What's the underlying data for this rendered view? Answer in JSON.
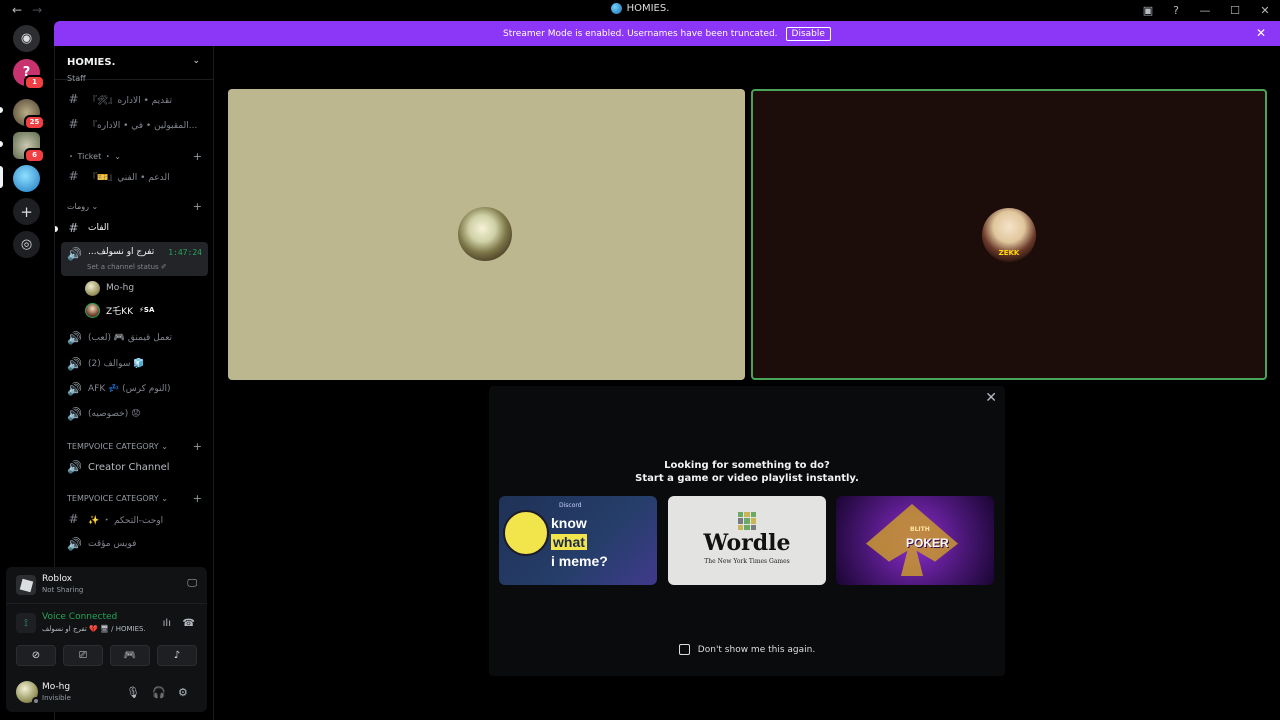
{
  "window": {
    "title": "HOMIES.",
    "back_glyph": "←",
    "forward_glyph": "→",
    "controls": [
      "▣",
      "?",
      "—",
      "☐",
      "✕"
    ]
  },
  "servers": [
    {
      "name": "discord-home",
      "glyph": "◉",
      "color": "#2b2d31",
      "badge": ""
    },
    {
      "name": "server-question",
      "glyph": "?",
      "color": "#c8326e",
      "badge": "1"
    },
    {
      "name": "server-avatar-a",
      "glyph": "",
      "color": "#5a4e3b",
      "badge": "25"
    },
    {
      "name": "server-avatar-b",
      "glyph": "",
      "color": "#7d8a6a",
      "badge": "6"
    },
    {
      "name": "server-avatar-c",
      "glyph": "",
      "color": "#2a8fcf",
      "badge": ""
    },
    {
      "name": "add-server",
      "glyph": "+",
      "color": "#1e1f22",
      "badge": ""
    },
    {
      "name": "discover",
      "glyph": "◎",
      "color": "#1e1f22",
      "badge": ""
    }
  ],
  "banner": {
    "text": "Streamer Mode is enabled. Usernames have been truncated.",
    "button": "Disable",
    "close": "✕"
  },
  "guild": {
    "name": "HOMIES.",
    "chevron": "⌄"
  },
  "channels": {
    "top_cut": "Staff",
    "c1": "『🛠』تقديم • الاداره",
    "c2": "『المقبولين • في • الاداره...",
    "cat_ticket": "・ Ticket ・ ⌄",
    "c3": "『🎫』الدعم • الفني",
    "cat_rooms": "رومات ⌄",
    "c4": "الفات",
    "active_name": "...تفرج او نسولف",
    "active_timer": "1:47:24",
    "active_status": "Set a channel status ✐",
    "voice_users": [
      {
        "name": "Mo-hg",
        "tag": ""
      },
      {
        "name": "Z乇KK",
        "tag": "⚡SA"
      }
    ],
    "c5": "(لعب) 🎮 تعمل قيمنق",
    "c6": "(2) سوالف 🧊",
    "c7": "AFK 💤 (النوم كرس)",
    "c8": "(خصوصيه) 😟",
    "cat_temp1": "TEMPVOICE CATEGORY ⌄",
    "c9": "Creator Channel",
    "cat_temp2": "TEMPVOICE CATEGORY ⌄",
    "c10": "✨ ・ اوحت-التحكم",
    "c11": "فويس مؤقت"
  },
  "panel": {
    "game_title": "Roblox",
    "game_sub": "Not Sharing",
    "vc_title": "Voice Connected",
    "vc_sub": "تفرج او نسولف 💔 🖥 / HOMIES.",
    "user_name": "Mo-hg",
    "user_status": "Invisible",
    "icons": {
      "mic": "🎙",
      "headset": "🎧",
      "gear": "⚙",
      "hangup": "☎",
      "waveform": "ılı",
      "signal": "⟟"
    }
  },
  "call": {
    "tile2_label": "ZEKK"
  },
  "activity": {
    "line1": "Looking for something to do?",
    "line2": "Start a game or video playlist instantly.",
    "close": "✕",
    "cards": [
      {
        "name": "know-what-i-meme",
        "tag": "Discord",
        "l1": "know",
        "l2": "what",
        "l3": "i meme?"
      },
      {
        "name": "wordle",
        "title": "Wordle",
        "sub": "The New York Times Games"
      },
      {
        "name": "poker",
        "small": "BLITH",
        "title": "POKER"
      }
    ],
    "dont_show": "Don't show me this again."
  }
}
